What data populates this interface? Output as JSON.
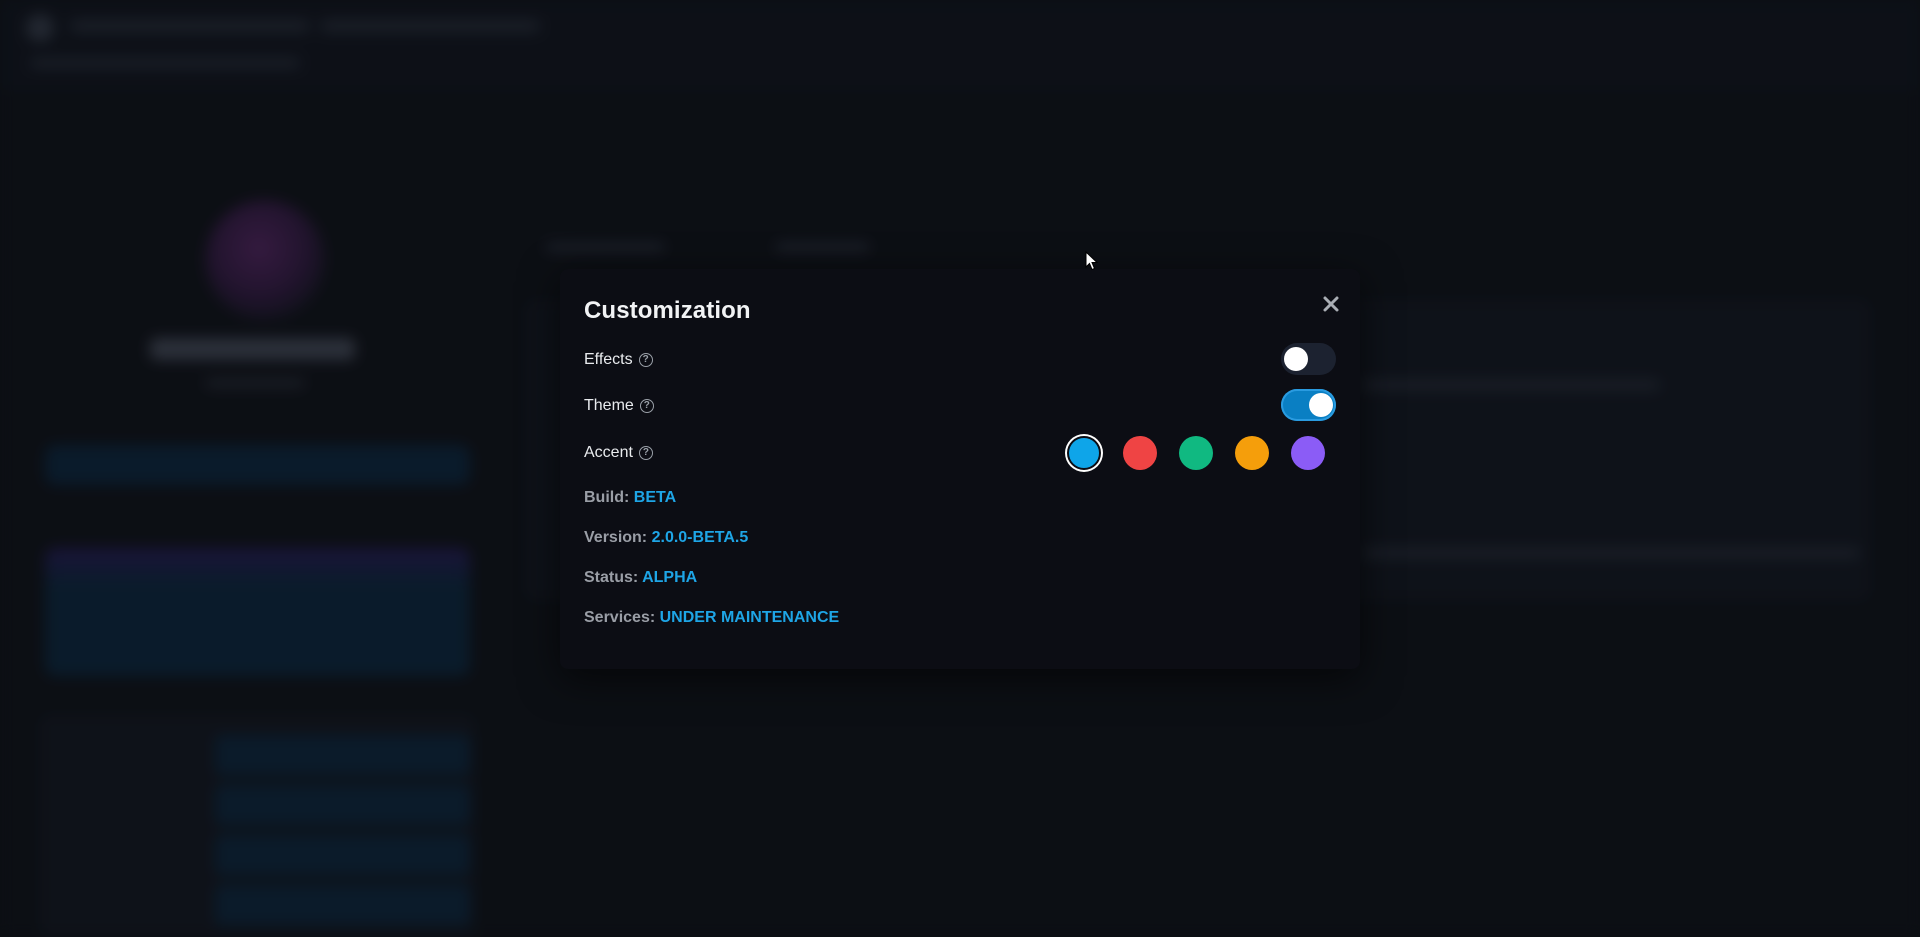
{
  "modal": {
    "title": "Customization",
    "close_icon": "close-icon",
    "settings": {
      "effects": {
        "label": "Effects",
        "help": "?",
        "enabled": false
      },
      "theme": {
        "label": "Theme",
        "help": "?",
        "enabled": true
      },
      "accent": {
        "label": "Accent",
        "help": "?",
        "colors": [
          "#0ea5e9",
          "#ef4444",
          "#10b981",
          "#f59e0b",
          "#8b5cf6"
        ],
        "selected_index": 0
      }
    },
    "info": {
      "build": {
        "key": "Build:",
        "value": "BETA"
      },
      "version": {
        "key": "Version:",
        "value": "2.0.0-BETA.5"
      },
      "status": {
        "key": "Status:",
        "value": "ALPHA"
      },
      "services": {
        "key": "Services:",
        "value": "UNDER MAINTENANCE"
      }
    }
  },
  "colors": {
    "accent": "#1ea5e6",
    "toggle_on": "#0a7fc3",
    "modal_bg": "#0c0d14"
  }
}
